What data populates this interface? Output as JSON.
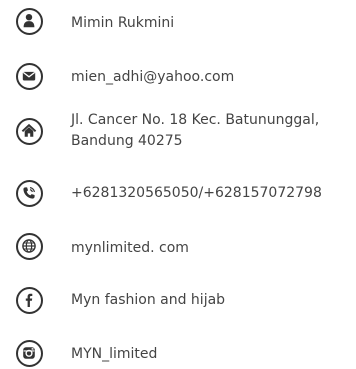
{
  "contacts": {
    "name": {
      "icon": "person-icon",
      "text": "Mimin Rukmini"
    },
    "email": {
      "icon": "envelope-icon",
      "text": "mien_adhi@yahoo.com"
    },
    "address": {
      "icon": "home-icon",
      "line1": "Jl. Cancer No. 18 Kec. Batununggal,",
      "line2": "Bandung 40275"
    },
    "phone": {
      "icon": "phone-icon",
      "text": "+6281320565050/+628157072798"
    },
    "website": {
      "icon": "globe-icon",
      "text": "mynlimited. com"
    },
    "facebook": {
      "icon": "facebook-icon",
      "text": "Myn fashion and hijab"
    },
    "instagram": {
      "icon": "instagram-icon",
      "text": "MYN_limited"
    }
  },
  "colors": {
    "icon": "#333333",
    "text": "#444444",
    "background": "#ffffff"
  }
}
